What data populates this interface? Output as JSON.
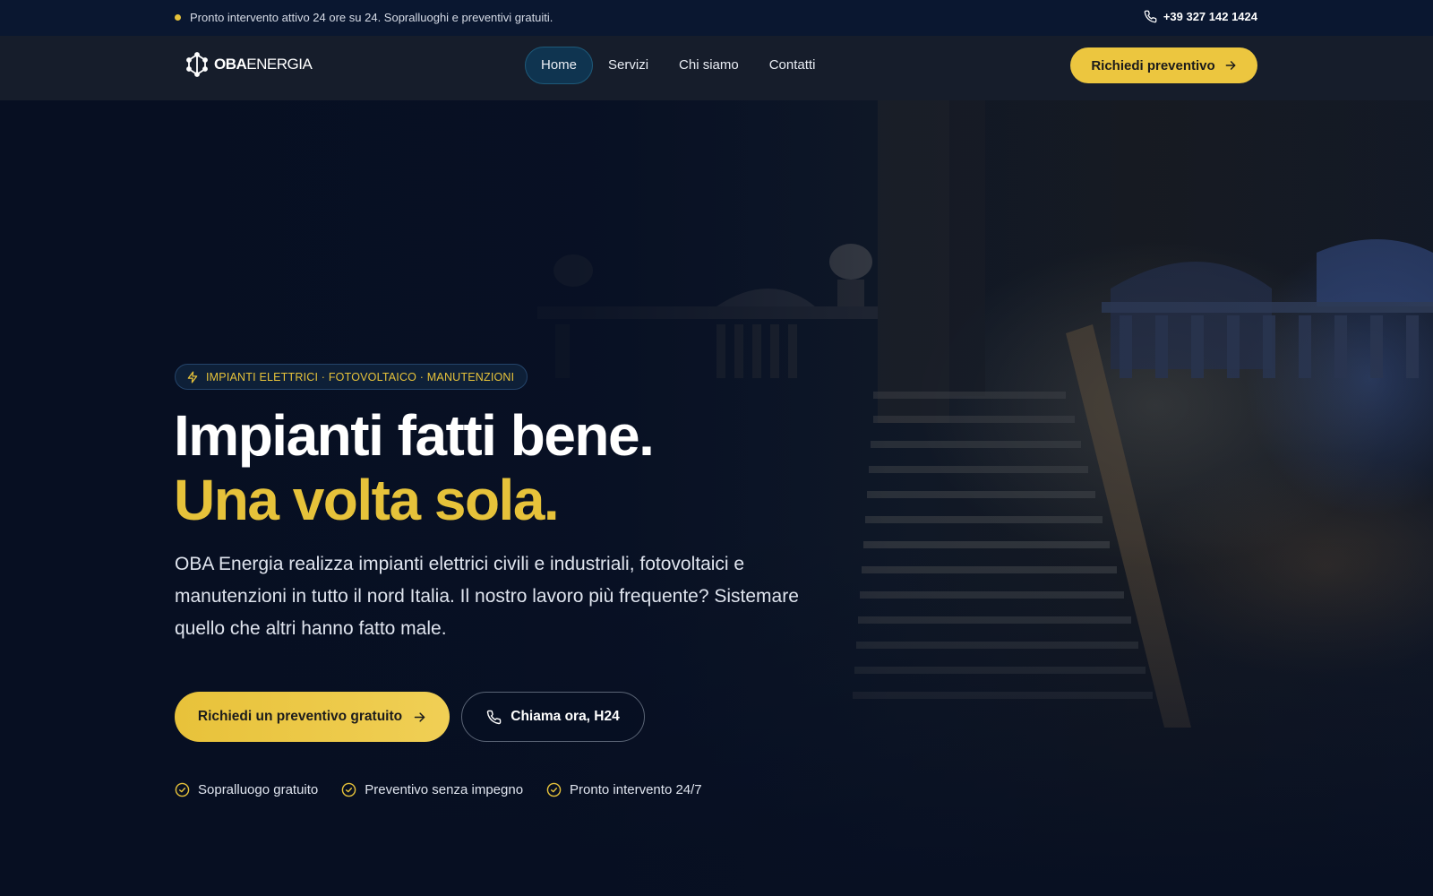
{
  "topbar": {
    "message": "Pronto intervento attivo 24 ore su 24. Sopralluoghi e preventivi gratuiti.",
    "phone": "+39 327 142 1424"
  },
  "nav": {
    "logo_bold": "OBA",
    "logo_light": "ENERGIA",
    "items": [
      {
        "label": "Home",
        "active": true
      },
      {
        "label": "Servizi"
      },
      {
        "label": "Chi siamo"
      },
      {
        "label": "Contatti"
      }
    ],
    "cta_label": "Richiedi preventivo"
  },
  "hero": {
    "badge": "IMPIANTI ELETTRICI · FOTOVOLTAICO · MANUTENZIONI",
    "title_line1": "Impianti fatti bene.",
    "title_line2": "Una volta sola.",
    "lead": "OBA Energia realizza impianti elettrici civili e industriali, fotovoltaici e manutenzioni in tutto il nord Italia. Il nostro lavoro più frequente? Sistemare quello che altri hanno fatto male.",
    "primary_cta": "Richiedi un preventivo gratuito",
    "secondary_cta": "Chiama ora, H24",
    "features": [
      "Sopralluogo gratuito",
      "Preventivo senza impegno",
      "Pronto intervento 24/7"
    ]
  },
  "colors": {
    "accent": "#e6c23a",
    "background": "#070f22",
    "nav": "#161d2b",
    "topbar": "#0a1730"
  }
}
